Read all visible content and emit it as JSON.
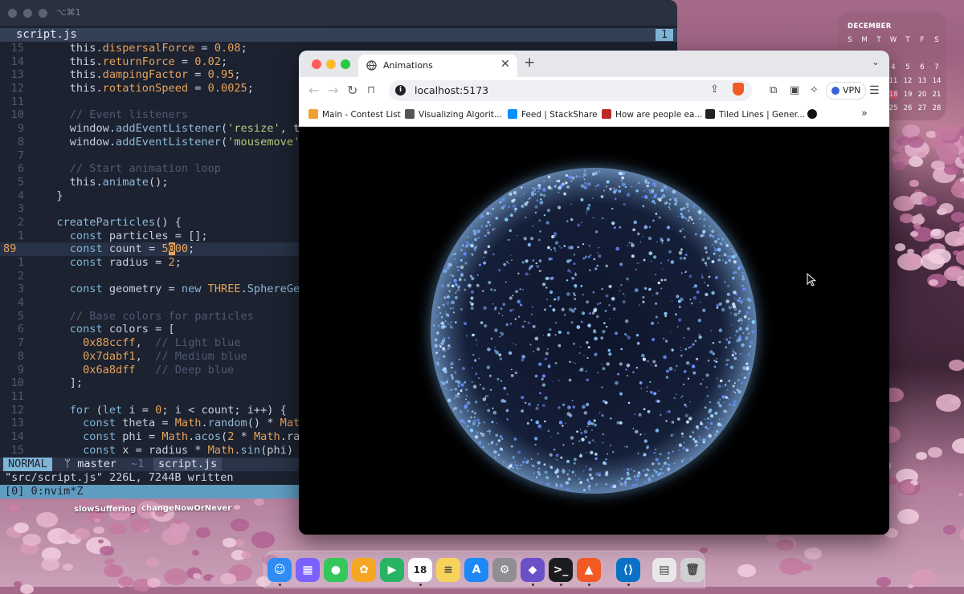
{
  "desktop": {
    "labels": [
      "slowSuffering",
      "changeNowOrNever"
    ]
  },
  "calendar": {
    "month": "DECEMBER",
    "weekdays": [
      "S",
      "M",
      "T",
      "W",
      "T",
      "F",
      "S"
    ],
    "rows": [
      [
        "",
        "",
        "",
        "",
        "",
        "",
        ""
      ],
      [
        "",
        "",
        "",
        "4",
        "5",
        "6",
        "7"
      ],
      [
        "",
        "",
        "",
        "11",
        "12",
        "13",
        "14"
      ],
      [
        "",
        "",
        "",
        "18",
        "19",
        "20",
        "21"
      ],
      [
        "",
        "",
        "",
        "25",
        "26",
        "27",
        "28"
      ]
    ],
    "today": "18",
    "accent": "#e05a7a"
  },
  "terminal": {
    "title": "⌥⌘1",
    "tab_name": "script.js",
    "tab_number": "1",
    "status": {
      "mode": "NORMAL",
      "branch": "ᛘ master",
      "changes": "~1",
      "file": "script.js"
    },
    "message": "\"src/script.js\" 226L, 7244B written",
    "tmux": "[0] 0:nvim*Z"
  },
  "code_lines": [
    {
      "n": "15",
      "t": [
        [
          "t-pl",
          "    this."
        ],
        [
          "t-prop",
          "dispersalForce"
        ],
        [
          "t-pl",
          " = "
        ],
        [
          "t-num",
          "0.08"
        ],
        [
          "t-pl",
          ";"
        ]
      ]
    },
    {
      "n": "14",
      "t": [
        [
          "t-pl",
          "    this."
        ],
        [
          "t-prop",
          "returnForce"
        ],
        [
          "t-pl",
          " = "
        ],
        [
          "t-num",
          "0.02"
        ],
        [
          "t-pl",
          ";"
        ]
      ]
    },
    {
      "n": "13",
      "t": [
        [
          "t-pl",
          "    this."
        ],
        [
          "t-prop",
          "dampingFactor"
        ],
        [
          "t-pl",
          " = "
        ],
        [
          "t-num",
          "0.95"
        ],
        [
          "t-pl",
          ";"
        ]
      ]
    },
    {
      "n": "12",
      "t": [
        [
          "t-pl",
          "    this."
        ],
        [
          "t-prop",
          "rotationSpeed"
        ],
        [
          "t-pl",
          " = "
        ],
        [
          "t-num",
          "0.0025"
        ],
        [
          "t-pl",
          ";"
        ]
      ]
    },
    {
      "n": "11",
      "t": []
    },
    {
      "n": "10",
      "t": [
        [
          "t-cm",
          "    // Event listeners"
        ]
      ]
    },
    {
      "n": "9",
      "t": [
        [
          "t-pl",
          "    window."
        ],
        [
          "t-fn",
          "addEventListener"
        ],
        [
          "t-pl",
          "("
        ],
        [
          "t-str",
          "'resize'"
        ],
        [
          "t-pl",
          ", th"
        ]
      ]
    },
    {
      "n": "8",
      "t": [
        [
          "t-pl",
          "    window."
        ],
        [
          "t-fn",
          "addEventListener"
        ],
        [
          "t-pl",
          "("
        ],
        [
          "t-str",
          "'mousemove'"
        ],
        [
          "t-pl",
          ","
        ]
      ]
    },
    {
      "n": "7",
      "t": []
    },
    {
      "n": "6",
      "t": [
        [
          "t-cm",
          "    // Start animation loop"
        ]
      ]
    },
    {
      "n": "5",
      "t": [
        [
          "t-pl",
          "    this."
        ],
        [
          "t-fn",
          "animate"
        ],
        [
          "t-pl",
          "();"
        ]
      ]
    },
    {
      "n": "4",
      "t": [
        [
          "t-pl",
          "  }"
        ]
      ]
    },
    {
      "n": "3",
      "t": []
    },
    {
      "n": "2",
      "t": [
        [
          "t-pl",
          "  "
        ],
        [
          "t-fn",
          "createParticles"
        ],
        [
          "t-pl",
          "() {"
        ]
      ]
    },
    {
      "n": "1",
      "t": [
        [
          "t-pl",
          "    "
        ],
        [
          "t-kw",
          "const"
        ],
        [
          "t-pl",
          " particles = [];"
        ]
      ]
    },
    {
      "n": "89",
      "active": true,
      "t": [
        [
          "t-pl",
          "    "
        ],
        [
          "t-kw",
          "const"
        ],
        [
          "t-pl",
          " count = "
        ],
        [
          "t-num",
          "5"
        ],
        [
          "cursor-ch",
          "0"
        ],
        [
          "t-num",
          "00"
        ],
        [
          "t-pl",
          ";"
        ]
      ]
    },
    {
      "n": "1",
      "t": [
        [
          "t-pl",
          "    "
        ],
        [
          "t-kw",
          "const"
        ],
        [
          "t-pl",
          " radius = "
        ],
        [
          "t-num",
          "2"
        ],
        [
          "t-pl",
          ";"
        ]
      ]
    },
    {
      "n": "2",
      "t": []
    },
    {
      "n": "3",
      "t": [
        [
          "t-pl",
          "    "
        ],
        [
          "t-kw",
          "const"
        ],
        [
          "t-pl",
          " geometry = "
        ],
        [
          "t-kw",
          "new"
        ],
        [
          "t-pl",
          " "
        ],
        [
          "t-cls",
          "THREE"
        ],
        [
          "t-pl",
          "."
        ],
        [
          "t-fn",
          "SphereGeo"
        ]
      ]
    },
    {
      "n": "4",
      "t": []
    },
    {
      "n": "5",
      "t": [
        [
          "t-cm",
          "    // Base colors for particles"
        ]
      ]
    },
    {
      "n": "6",
      "t": [
        [
          "t-pl",
          "    "
        ],
        [
          "t-kw",
          "const"
        ],
        [
          "t-pl",
          " colors = ["
        ]
      ]
    },
    {
      "n": "7",
      "t": [
        [
          "t-pl",
          "      "
        ],
        [
          "t-num",
          "0x88ccff"
        ],
        [
          "t-pl",
          ",  "
        ],
        [
          "t-cm",
          "// Light blue"
        ]
      ]
    },
    {
      "n": "8",
      "t": [
        [
          "t-pl",
          "      "
        ],
        [
          "t-num",
          "0x7dabf1"
        ],
        [
          "t-pl",
          ",  "
        ],
        [
          "t-cm",
          "// Medium blue"
        ]
      ]
    },
    {
      "n": "9",
      "t": [
        [
          "t-pl",
          "      "
        ],
        [
          "t-num",
          "0x6a8dff"
        ],
        [
          "t-pl",
          "   "
        ],
        [
          "t-cm",
          "// Deep blue"
        ]
      ]
    },
    {
      "n": "10",
      "t": [
        [
          "t-pl",
          "    ];"
        ]
      ]
    },
    {
      "n": "11",
      "t": []
    },
    {
      "n": "12",
      "t": [
        [
          "t-pl",
          "    "
        ],
        [
          "t-kw",
          "for"
        ],
        [
          "t-pl",
          " ("
        ],
        [
          "t-kw",
          "let"
        ],
        [
          "t-pl",
          " i = "
        ],
        [
          "t-num",
          "0"
        ],
        [
          "t-pl",
          "; i < count; i++) {"
        ]
      ]
    },
    {
      "n": "13",
      "t": [
        [
          "t-pl",
          "      "
        ],
        [
          "t-kw",
          "const"
        ],
        [
          "t-pl",
          " theta = "
        ],
        [
          "t-cls",
          "Math"
        ],
        [
          "t-pl",
          "."
        ],
        [
          "t-fn",
          "random"
        ],
        [
          "t-pl",
          "() * "
        ],
        [
          "t-cls",
          "Math"
        ]
      ]
    },
    {
      "n": "14",
      "t": [
        [
          "t-pl",
          "      "
        ],
        [
          "t-kw",
          "const"
        ],
        [
          "t-pl",
          " phi = "
        ],
        [
          "t-cls",
          "Math"
        ],
        [
          "t-pl",
          "."
        ],
        [
          "t-fn",
          "acos"
        ],
        [
          "t-pl",
          "("
        ],
        [
          "t-num",
          "2"
        ],
        [
          "t-pl",
          " * "
        ],
        [
          "t-cls",
          "Math"
        ],
        [
          "t-pl",
          ".ran"
        ]
      ]
    },
    {
      "n": "15",
      "t": [
        [
          "t-pl",
          "      "
        ],
        [
          "t-kw",
          "const"
        ],
        [
          "t-pl",
          " x = radius * "
        ],
        [
          "t-cls",
          "Math"
        ],
        [
          "t-pl",
          "."
        ],
        [
          "t-fn",
          "sin"
        ],
        [
          "t-pl",
          "(phi) *"
        ]
      ]
    }
  ],
  "browser": {
    "tab_title": "Animations",
    "url": "localhost:5173",
    "vpn_label": "VPN",
    "bookmarks": [
      {
        "label": "Main - Contest List",
        "color": "#f0a030"
      },
      {
        "label": "Visualizing Algorit...",
        "color": "#555"
      },
      {
        "label": "Feed | StackShare",
        "color": "#0690fa"
      },
      {
        "label": "How are people ea...",
        "color": "#b92b27"
      },
      {
        "label": "Tiled Lines | Gener...",
        "color": "#222"
      },
      {
        "label": "",
        "color": "#111"
      }
    ],
    "more": "»"
  },
  "dock": {
    "apps": [
      {
        "name": "finder",
        "color": "#2f8cf5",
        "glyph": "☺"
      },
      {
        "name": "launchpad",
        "color": "#7b61ff",
        "glyph": "▦"
      },
      {
        "name": "messages",
        "color": "#34c759",
        "glyph": "●"
      },
      {
        "name": "photos",
        "color": "#f5a623",
        "glyph": "✿"
      },
      {
        "name": "facetime",
        "color": "#28b463",
        "glyph": "▶"
      },
      {
        "name": "calendar",
        "color": "#ffffff",
        "glyph": "18"
      },
      {
        "name": "notes",
        "color": "#f7d35b",
        "glyph": "≡"
      },
      {
        "name": "app-store",
        "color": "#1e88f7",
        "glyph": "A"
      },
      {
        "name": "system-settings",
        "color": "#8e8e93",
        "glyph": "⚙"
      },
      {
        "name": "obsidian",
        "color": "#6b4fc9",
        "glyph": "◆"
      },
      {
        "name": "terminal",
        "color": "#1c1c1e",
        "glyph": ">_"
      },
      {
        "name": "brave",
        "color": "#f15a24",
        "glyph": "▲"
      },
      {
        "name": "vscode",
        "color": "#0a72c6",
        "glyph": "⟨⟩"
      },
      {
        "name": "preview",
        "color": "#e8e8e8",
        "glyph": "▤"
      },
      {
        "name": "trash",
        "color": "#d0d0d0",
        "glyph": "🗑"
      }
    ]
  }
}
